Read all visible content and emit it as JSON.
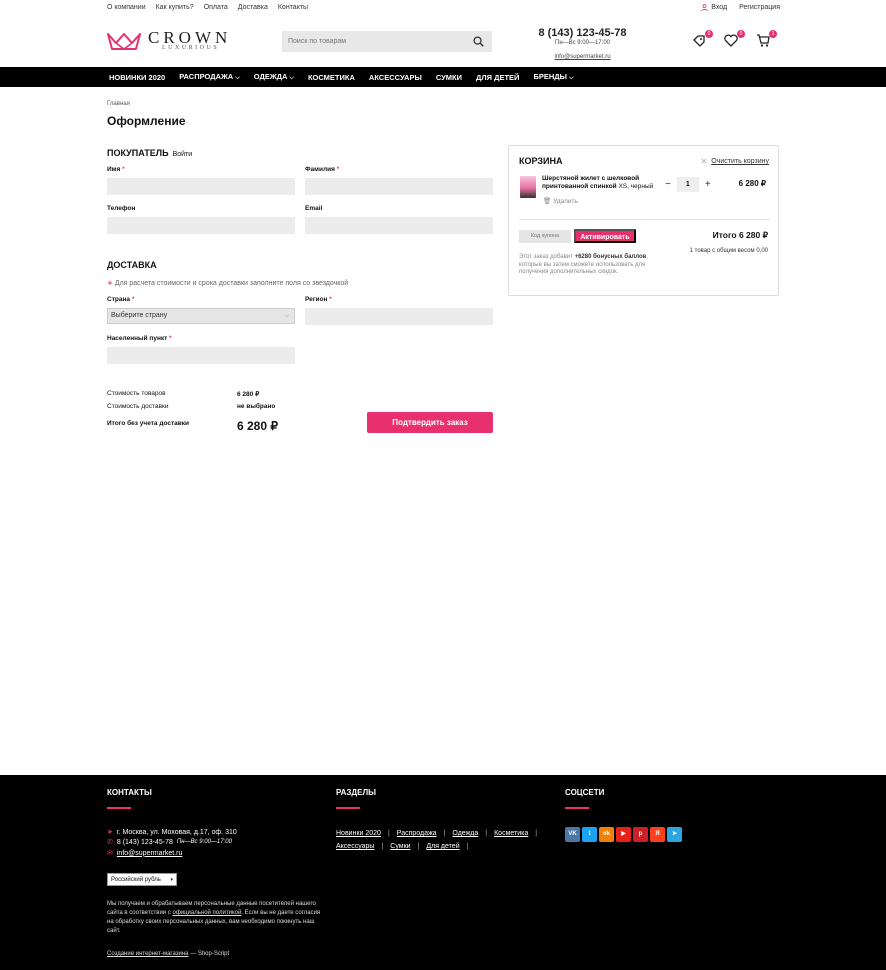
{
  "topbar": {
    "links": [
      "О компании",
      "Как купить?",
      "Оплата",
      "Доставка",
      "Контакты"
    ],
    "login": "Вход",
    "register": "Регистрация"
  },
  "header": {
    "logo_name": "CROWN",
    "logo_sub": "LUXURIOUS",
    "search_placeholder": "Поиск по товарам",
    "phone": "8 (143) 123-45-78",
    "hours": "Пн—Вс 9:00—17:00",
    "email": "info@supermarket.ru",
    "badges": {
      "compare": "0",
      "favorites": "0",
      "cart": "1"
    }
  },
  "nav": {
    "items": [
      {
        "label": "НОВИНКИ 2020",
        "dropdown": false
      },
      {
        "label": "РАСПРОДАЖА",
        "dropdown": true
      },
      {
        "label": "ОДЕЖДА",
        "dropdown": true
      },
      {
        "label": "КОСМЕТИКА",
        "dropdown": false
      },
      {
        "label": "АКСЕССУАРЫ",
        "dropdown": false
      },
      {
        "label": "СУМКИ",
        "dropdown": false
      },
      {
        "label": "ДЛЯ ДЕТЕЙ",
        "dropdown": false
      },
      {
        "label": "БРЕНДЫ",
        "dropdown": true
      }
    ]
  },
  "page": {
    "breadcrumb": "Главная",
    "title": "Оформление"
  },
  "buyer": {
    "heading": "ПОКУПАТЕЛЬ",
    "login_link": "Войти",
    "first_name": "Имя",
    "last_name": "Фамилия",
    "phone": "Телефон",
    "email": "Email",
    "required_mark": "*"
  },
  "delivery": {
    "heading": "ДОСТАВКА",
    "hint": "Для расчета стоимости и срока доставки заполните поля со звездочкой",
    "country": "Страна",
    "country_value": "Выберите страну",
    "region": "Регион",
    "city": "Населенный пункт"
  },
  "summary": {
    "goods_label": "Стоимость товаров",
    "goods_value": "6 280 ₽",
    "delivery_label": "Стоимость доставки",
    "delivery_value": "не выбрано",
    "total_label": "Итого без учета доставки",
    "total_value": "6 280 ₽",
    "confirm": "Подтвердить заказ"
  },
  "cart": {
    "heading": "КОРЗИНА",
    "clear": "Очистить корзину",
    "item_name": "Шерстяной жилет с шелковой принтованной спинкой",
    "item_options": "XS, черный",
    "item_delete": "Удалить",
    "item_qty": "1",
    "item_price": "6 280 ₽",
    "coupon_placeholder": "Код купона",
    "activate": "Активировать",
    "total": "Итого 6 280 ₽",
    "weight": "1 товар с общим весом 0,00",
    "bonus_pre": "Этот заказ добавит ",
    "bonus_amount": "+6280 бонусных баллов",
    "bonus_post": ", которые вы затем сможете использовать для получения дополнительных скидок."
  },
  "footer": {
    "contacts_heading": "КОНТАКТЫ",
    "sections_heading": "РАЗДЕЛЫ",
    "social_heading": "СОЦСЕТИ",
    "address": "г. Москва, ул. Моховая, д.17, оф. 310",
    "phone": "8 (143) 123-45-78",
    "hours": "Пн—Вс 9:00—17:00",
    "email": "info@supermarket.ru",
    "menu": [
      "Новинки 2020",
      "Распродажа",
      "Одежда",
      "Косметика",
      "Аксессуары",
      "Сумки",
      "Для детей"
    ],
    "social": [
      {
        "name": "vk",
        "label": "VK",
        "color": "#4a76a8"
      },
      {
        "name": "twitter",
        "label": "t",
        "color": "#1da1f2"
      },
      {
        "name": "odnoklassniki",
        "label": "ok",
        "color": "#ee8208"
      },
      {
        "name": "youtube",
        "label": "▶",
        "color": "#e62117"
      },
      {
        "name": "pinterest",
        "label": "p",
        "color": "#cb2027"
      },
      {
        "name": "yandex",
        "label": "Я",
        "color": "#fc3f1d"
      },
      {
        "name": "telegram",
        "label": "➤",
        "color": "#2ca5e0"
      }
    ],
    "currency": "Российский рубль",
    "privacy_pre": "Мы получаем и обрабатываем персональные данные посетителей нашего сайта в соответствии с ",
    "privacy_link": "официальной политикой",
    "privacy_post": ". Если вы не даете согласия на обработку своих персональных данных, вам необходимо покинуть наш сайт.",
    "made_link": "Создание интернет-магазина",
    "made_post": " — Shop-Script"
  },
  "colors": {
    "accent": "#e8306f",
    "nav_bg": "#000000"
  }
}
